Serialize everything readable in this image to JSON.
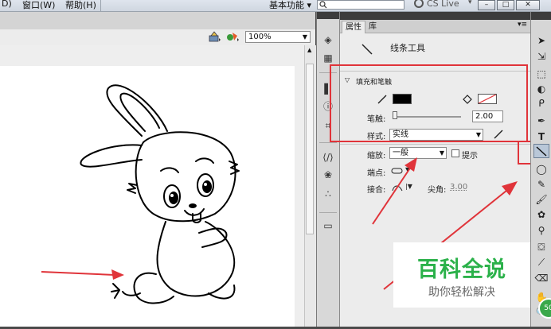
{
  "menu": {
    "items": [
      "D)",
      "窗口(W)",
      "帮助(H)"
    ],
    "workspace_label": "基本功能 ▾",
    "cs_live_label": "CS Live",
    "window_buttons": [
      "–",
      "□",
      "✕"
    ]
  },
  "stage": {
    "zoom": "100%"
  },
  "panel": {
    "tabs": [
      "属性",
      "库"
    ],
    "tool_name": "线条工具",
    "section_title": "填充和笔触",
    "stroke_color": "#000000",
    "stroke_label": "笔触:",
    "stroke_value": "2.00",
    "style_label": "样式:",
    "style_value": "实线",
    "scale_label": "缩放:",
    "scale_value": "一般",
    "hint_label": "提示",
    "cap_label": "端点:",
    "join_label": "接合:",
    "miter_label": "尖角:",
    "miter_value": "3.00"
  },
  "watermark": {
    "title": "百科全说",
    "subtitle": "助你轻松解决"
  },
  "colors": {
    "annotation_red": "#e0343a",
    "watermark_green": "#2bb14a"
  }
}
